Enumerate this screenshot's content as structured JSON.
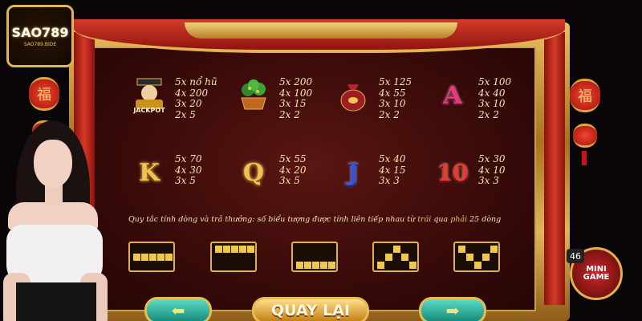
{
  "logo": {
    "main": "SAO789",
    "sub": "SAO789.BIDE"
  },
  "lantern_char": "福",
  "symbols": [
    {
      "name": "jackpot-god",
      "label": "JACKPOT",
      "pays": [
        "5x nổ hũ",
        "4x 200",
        "3x 20",
        "2x 5"
      ]
    },
    {
      "name": "money-tree",
      "pays": [
        "5x 200",
        "4x 100",
        "3x 15",
        "2x 2"
      ]
    },
    {
      "name": "gold-bag",
      "pays": [
        "5x 125",
        "4x 55",
        "3x 10",
        "2x 2"
      ]
    },
    {
      "name": "letter-A",
      "letter": "A",
      "pays": [
        "5x 100",
        "4x 40",
        "3x 10",
        "2x 2"
      ]
    },
    {
      "name": "letter-K",
      "letter": "K",
      "pays": [
        "5x 70",
        "4x 30",
        "3x 5"
      ]
    },
    {
      "name": "letter-Q",
      "letter": "Q",
      "pays": [
        "5x 55",
        "4x 20",
        "3x 5"
      ]
    },
    {
      "name": "letter-J",
      "letter": "J",
      "pays": [
        "5x 40",
        "4x 15",
        "3x 3"
      ]
    },
    {
      "name": "number-10",
      "letter": "10",
      "pays": [
        "5x 30",
        "4x 10",
        "3x 3"
      ]
    }
  ],
  "rule": {
    "prefix": "Quy tắc tính dòng và trả thưởng: số biểu tượng được tính liên tiếp nhau từ ",
    "from": "trái",
    "middle": " qua ",
    "to": "phải",
    "suffix": " 25 dòng"
  },
  "buttons": {
    "back_label": "QUAY LẠI",
    "prev_glyph": "⬅",
    "next_glyph": "➡"
  },
  "mini_game": {
    "line1": "MINI",
    "line2": "GAME",
    "badge": "46"
  },
  "colors": {
    "gold": "#e0b24e",
    "red_panel": "#3a0b09",
    "teal_button": "#158a78",
    "highlight": "#f7c23a"
  }
}
